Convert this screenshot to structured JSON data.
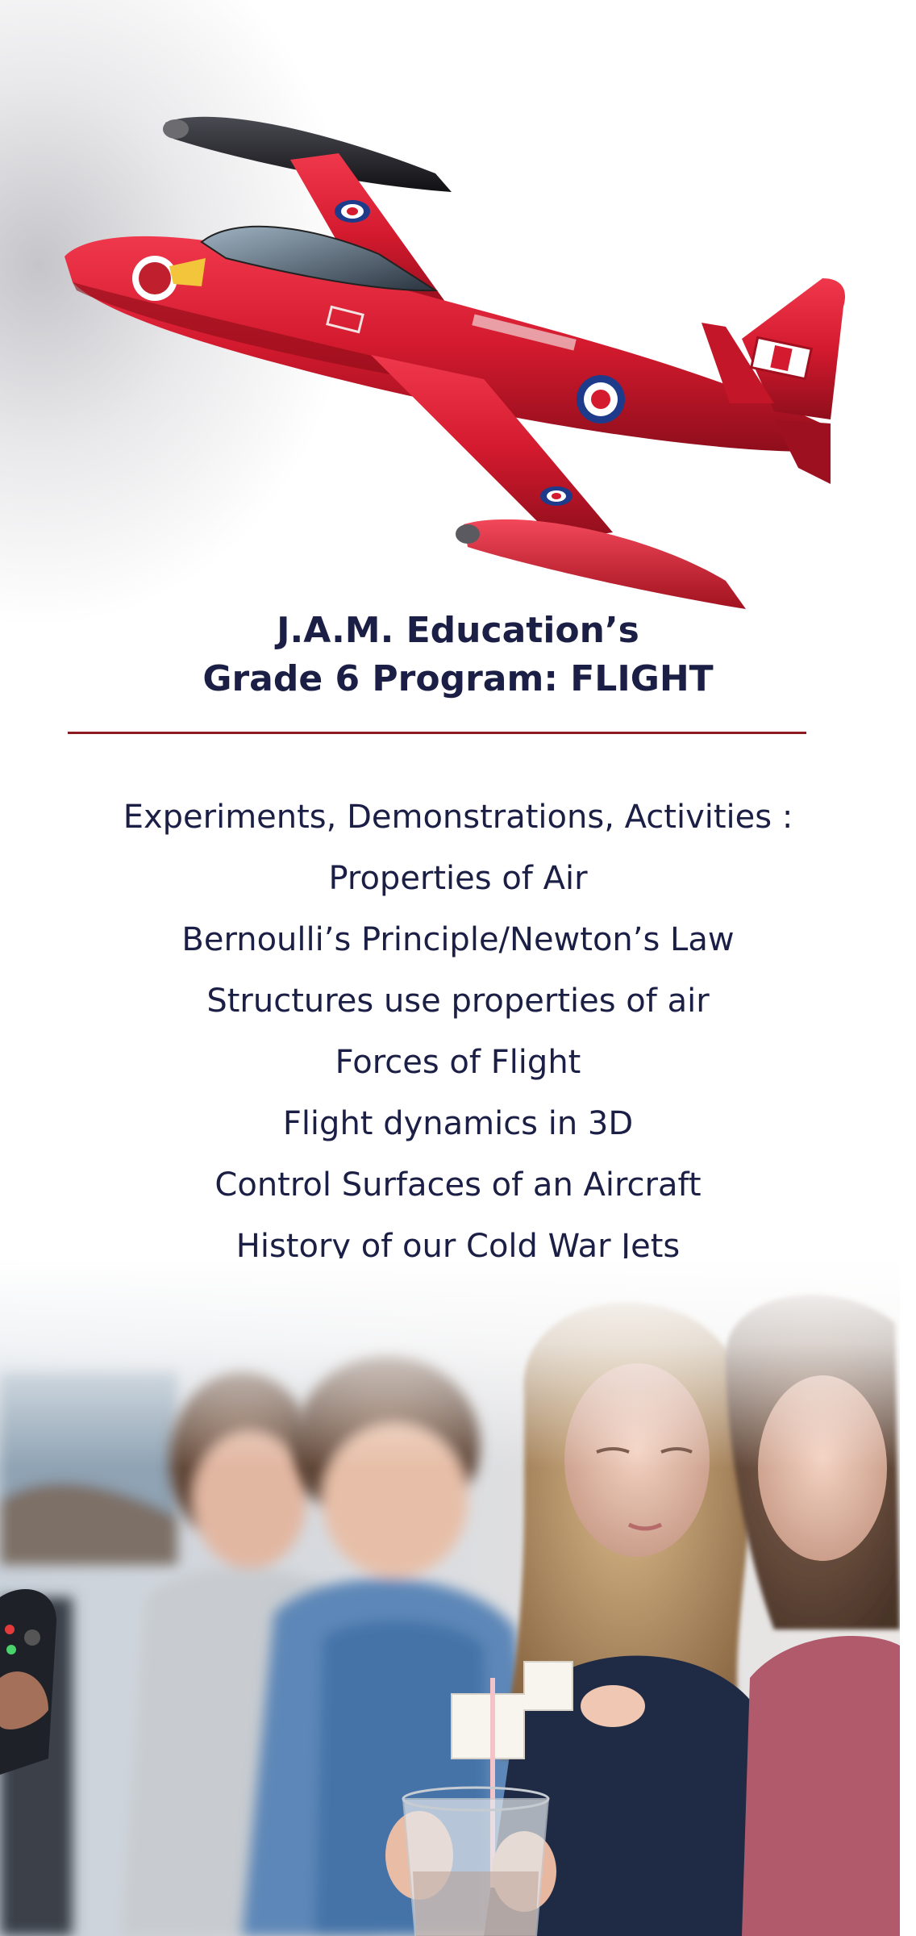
{
  "title": {
    "line1": "J.A.M. Education’s",
    "line2": "Grade 6 Program: FLIGHT"
  },
  "topics": [
    "Experiments, Demonstrations, Activities :",
    "Properties of Air",
    "Bernoulli’s Principle/Newton’s Law",
    "Structures use properties of air",
    "Forces of Flight",
    "Flight dynamics in 3D",
    "Control Surfaces of an Aircraft",
    "History of our Cold War Jets"
  ],
  "colors": {
    "title_text": "#1c1f45",
    "rule": "#8e1b22",
    "jet_red": "#d41a2e"
  },
  "images": {
    "hero": "red-jet-aircraft-photo",
    "bottom": "students-experiment-photo"
  }
}
